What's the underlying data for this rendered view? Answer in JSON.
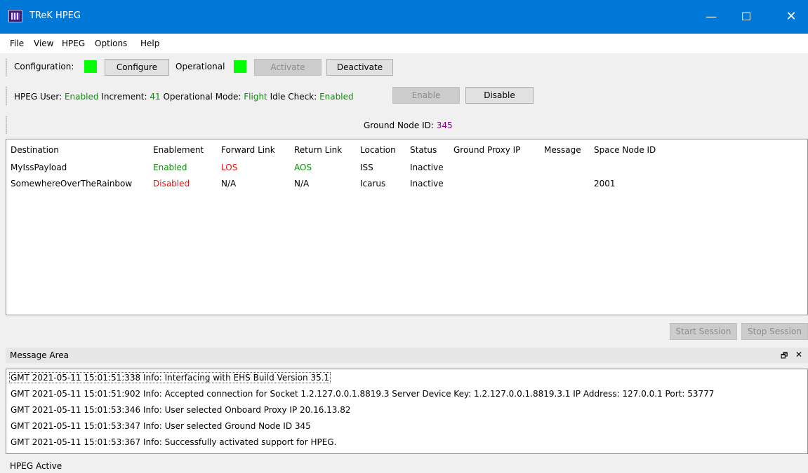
{
  "window": {
    "title": "TReK HPEG",
    "minimize_glyph": "—",
    "maximize_glyph": "☐",
    "close_glyph": "✕"
  },
  "menu": {
    "items": [
      "File",
      "View",
      "HPEG",
      "Options",
      "Help"
    ]
  },
  "toolbar1": {
    "configuration_label": "Configuration:",
    "configure_button": "Configure",
    "operational_label": "Operational",
    "activate_button": "Activate",
    "deactivate_button": "Deactivate",
    "indicator_color": "#00ff00"
  },
  "toolbar2": {
    "hpeg_user_label": "HPEG User:",
    "hpeg_user_value": "Enabled",
    "increment_label": "Increment:",
    "increment_value": "41",
    "operational_mode_label": "Operational Mode:",
    "operational_mode_value": "Flight",
    "idle_check_label": "Idle Check:",
    "idle_check_value": "Enabled",
    "enable_button": "Enable",
    "disable_button": "Disable"
  },
  "toolbar3": {
    "ground_node_label": "Ground Node ID:",
    "ground_node_value": "345"
  },
  "table": {
    "columns": [
      "Destination",
      "Enablement",
      "Forward Link",
      "Return Link",
      "Location",
      "Status",
      "Ground Proxy IP",
      "Message",
      "Space Node ID"
    ],
    "rows": [
      {
        "destination": "MyIssPayload",
        "enablement": "Enabled",
        "forward_link": "LOS",
        "return_link": "AOS",
        "location": "ISS",
        "status": "Inactive",
        "ground_proxy_ip": "",
        "message": "",
        "space_node_id": ""
      },
      {
        "destination": "SomewhereOverTheRainbow",
        "enablement": "Disabled",
        "forward_link": "N/A",
        "return_link": "N/A",
        "location": "Icarus",
        "status": "Inactive",
        "ground_proxy_ip": "",
        "message": "",
        "space_node_id": "2001"
      }
    ]
  },
  "session": {
    "start_button": "Start Session",
    "stop_button": "Stop Session"
  },
  "message_area": {
    "title": "Message Area",
    "float_glyph": "🗗",
    "close_glyph": "✕",
    "messages": [
      "GMT 2021-05-11 15:01:51:338  Info:  Interfacing with EHS Build Version 35.1",
      "GMT 2021-05-11 15:01:51:902  Info:  Accepted connection for Socket 1.2.127.0.0.1.8819.3 Server Device Key: 1.2.127.0.0.1.8819.3.1 IP Address: 127.0.0.1 Port: 53777",
      "GMT 2021-05-11 15:01:53:346  Info:  User selected Onboard Proxy IP 20.16.13.82",
      "GMT 2021-05-11 15:01:53:347  Info:  User selected Ground Node ID 345",
      "GMT 2021-05-11 15:01:53:367  Info:  Successfully activated support for HPEG."
    ]
  },
  "statusbar": {
    "text": "HPEG  Active"
  },
  "colors": {
    "titlebar": "#0078d7",
    "status_ok": "#0a8f0a",
    "status_bad": "#e81010",
    "node_id": "#800080"
  }
}
